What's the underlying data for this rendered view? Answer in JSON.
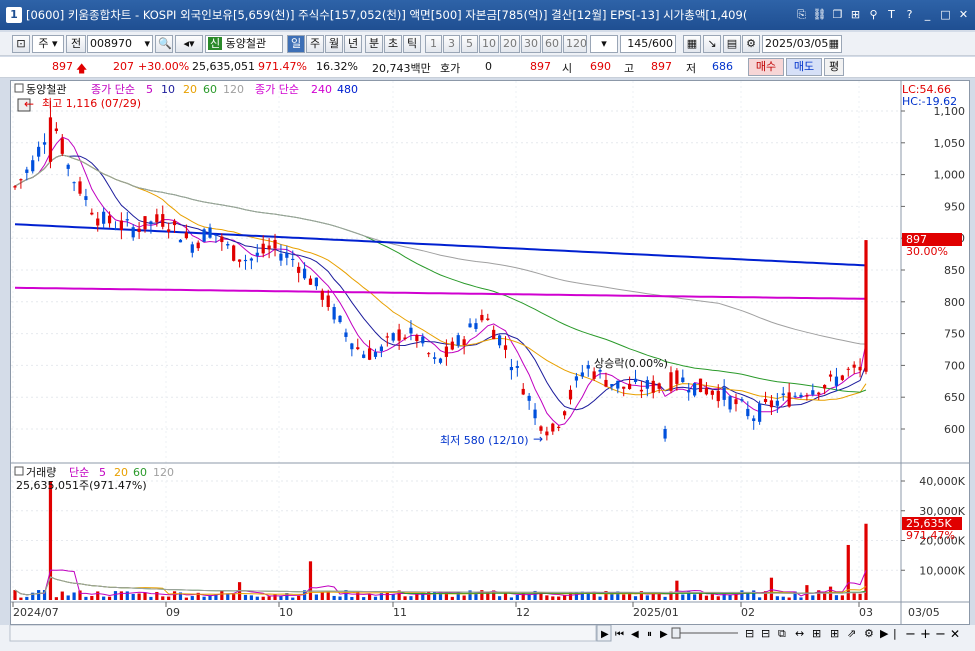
{
  "window": {
    "number": "1",
    "title": "[0600] 키움종합차트 - KOSPI 외국인보유[5,659(천)] 주식수[157,052(천)] 액면[500] 자본금[785(억)] 결산[12월] EPS[-13] 시가총액[1,409(",
    "buttons": [
      "⎘",
      "🔗",
      "□",
      "⊞",
      "📌",
      "T",
      "?",
      "_",
      "□",
      "X"
    ]
  },
  "toolbar": {
    "period_type": "주",
    "prev_label": "전",
    "code": "008970",
    "stock_name": "동양철관",
    "stock_tag": "신",
    "periods": [
      "일",
      "주",
      "월",
      "년",
      "분",
      "초",
      "틱"
    ],
    "selected_period": "일",
    "intervals": [
      "1",
      "3",
      "5",
      "10",
      "20",
      "30",
      "60",
      "120"
    ],
    "count": "145",
    "count_max": "/600",
    "date": "2025/03/05"
  },
  "quote": {
    "price": "897",
    "change": "207",
    "change_rate": "+30.00%",
    "volume": "25,635,051",
    "volume_rate": "971.47%",
    "turnover": "16.32%",
    "amount": "20,743백만",
    "bid_label": "호가",
    "bid_value": "0",
    "current": "897",
    "open_label": "시",
    "open": "690",
    "high_label": "고",
    "high": "897",
    "low_label": "저",
    "low": "686",
    "buy_label": "매수",
    "sell_label": "매도",
    "flat_label": "평"
  },
  "price_panel": {
    "legend": {
      "name": "동양철관",
      "ma_label": "종가 단순",
      "ma_periods": [
        "5",
        "10",
        "20",
        "60",
        "120"
      ],
      "ma2_label": "종가 단순",
      "ma2_periods": [
        "240",
        "480"
      ]
    },
    "high_annotation": "최고 1,116 (07/29)",
    "low_annotation": "최저 580 (12/10)",
    "mid_annotation": "상승락(0.00%)",
    "lc_label": "LC:54.66",
    "hc_label": "HC:-19.62",
    "price_tag": "897",
    "price_tag_rate": "30.00%",
    "y_ticks": [
      "1,100",
      "1,050",
      "1,000",
      "950",
      "900",
      "850",
      "800",
      "750",
      "700",
      "650",
      "600"
    ]
  },
  "volume_panel": {
    "legend_name": "거래량",
    "ma_label": "단순",
    "ma_periods": [
      "5",
      "20",
      "60",
      "120"
    ],
    "value_label": "25,635,051주(971.47%)",
    "y_ticks": [
      "40,000K",
      "30,000K",
      "20,000K",
      "10,000K"
    ],
    "tag": "25,635K",
    "tag_rate": "971.47%"
  },
  "x_axis": [
    "2024/07",
    "09",
    "10",
    "11",
    "12",
    "2025/01",
    "02",
    "03",
    "03/05"
  ],
  "colors": {
    "up": "#e00000",
    "down": "#0050dc",
    "ma5": "#c000c0",
    "ma10": "#1c1c9c",
    "ma20": "#e8a000",
    "ma60": "#2a9a2a",
    "ma120": "#a0a0a0",
    "ma240": "#d000d0",
    "ma480": "#0020d0"
  },
  "chart_data": {
    "type": "candlestick",
    "y_range": [
      560,
      1120
    ],
    "high": 1116,
    "low": 580,
    "last_close": 897
  }
}
